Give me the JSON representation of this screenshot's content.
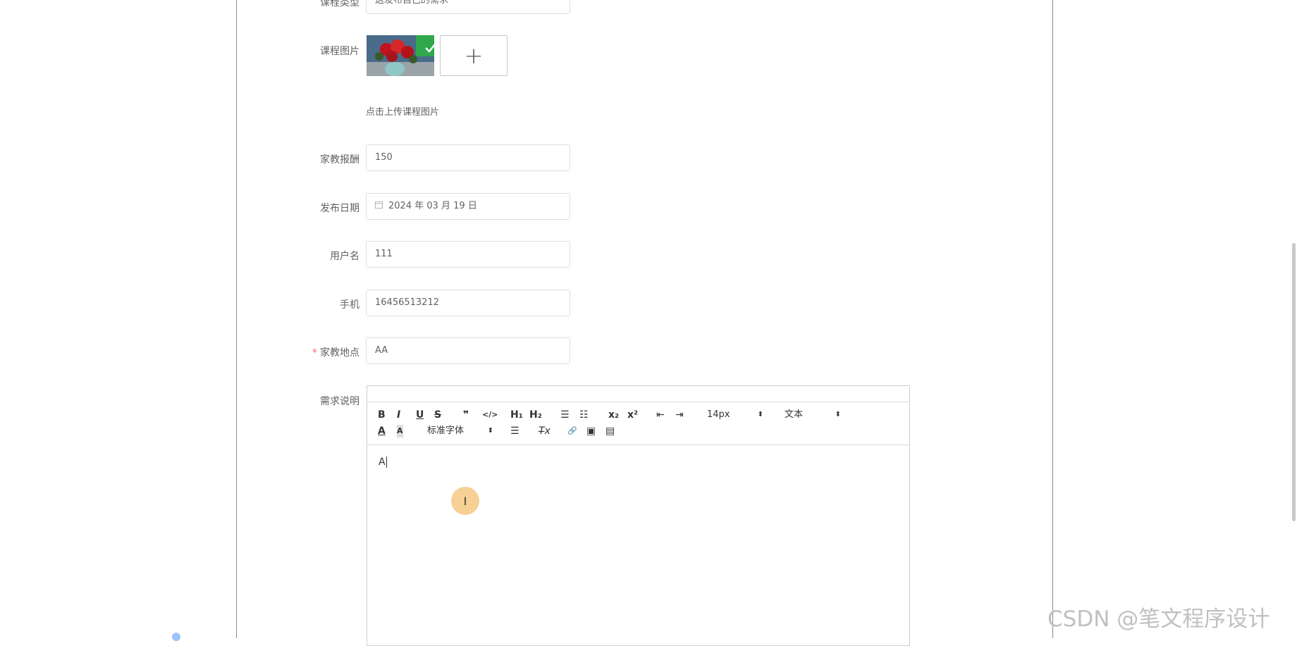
{
  "form": {
    "course_type": {
      "label": "课程类型",
      "value": "这发布自己的需求"
    },
    "course_image": {
      "label": "课程图片",
      "upload_hint": "点击上传课程图片",
      "add_symbol": "+"
    },
    "fee": {
      "label": "家教报酬",
      "value": "150"
    },
    "publish_date": {
      "label": "发布日期",
      "value": "2024 年 03 月 19 日",
      "icon": "calendar-icon"
    },
    "username": {
      "label": "用户名",
      "value": "111"
    },
    "phone": {
      "label": "手机",
      "value": "16456513212"
    },
    "location": {
      "label": "家教地点",
      "value": "AA",
      "required_mark": "*"
    },
    "description": {
      "label": "需求说明"
    }
  },
  "editor": {
    "toolbar": {
      "bold": "B",
      "italic": "I",
      "underline": "U",
      "strike": "S",
      "quote": "❞",
      "code": "</>",
      "h1": "H₁",
      "h2": "H₂",
      "ordered_list": "☰",
      "bullet_list": "☷",
      "subscript": "x₂",
      "superscript": "x²",
      "outdent": "⇤",
      "indent": "⇥",
      "font_size": "14px",
      "header_select": "文本",
      "font_color": "A",
      "bg_color": "A",
      "font_family": "标准字体",
      "align": "☰",
      "clean": "T̶x",
      "link": "🔗",
      "image": "▣",
      "video": "▤"
    },
    "content": "A"
  },
  "watermark": "CSDN @笔文程序设计"
}
